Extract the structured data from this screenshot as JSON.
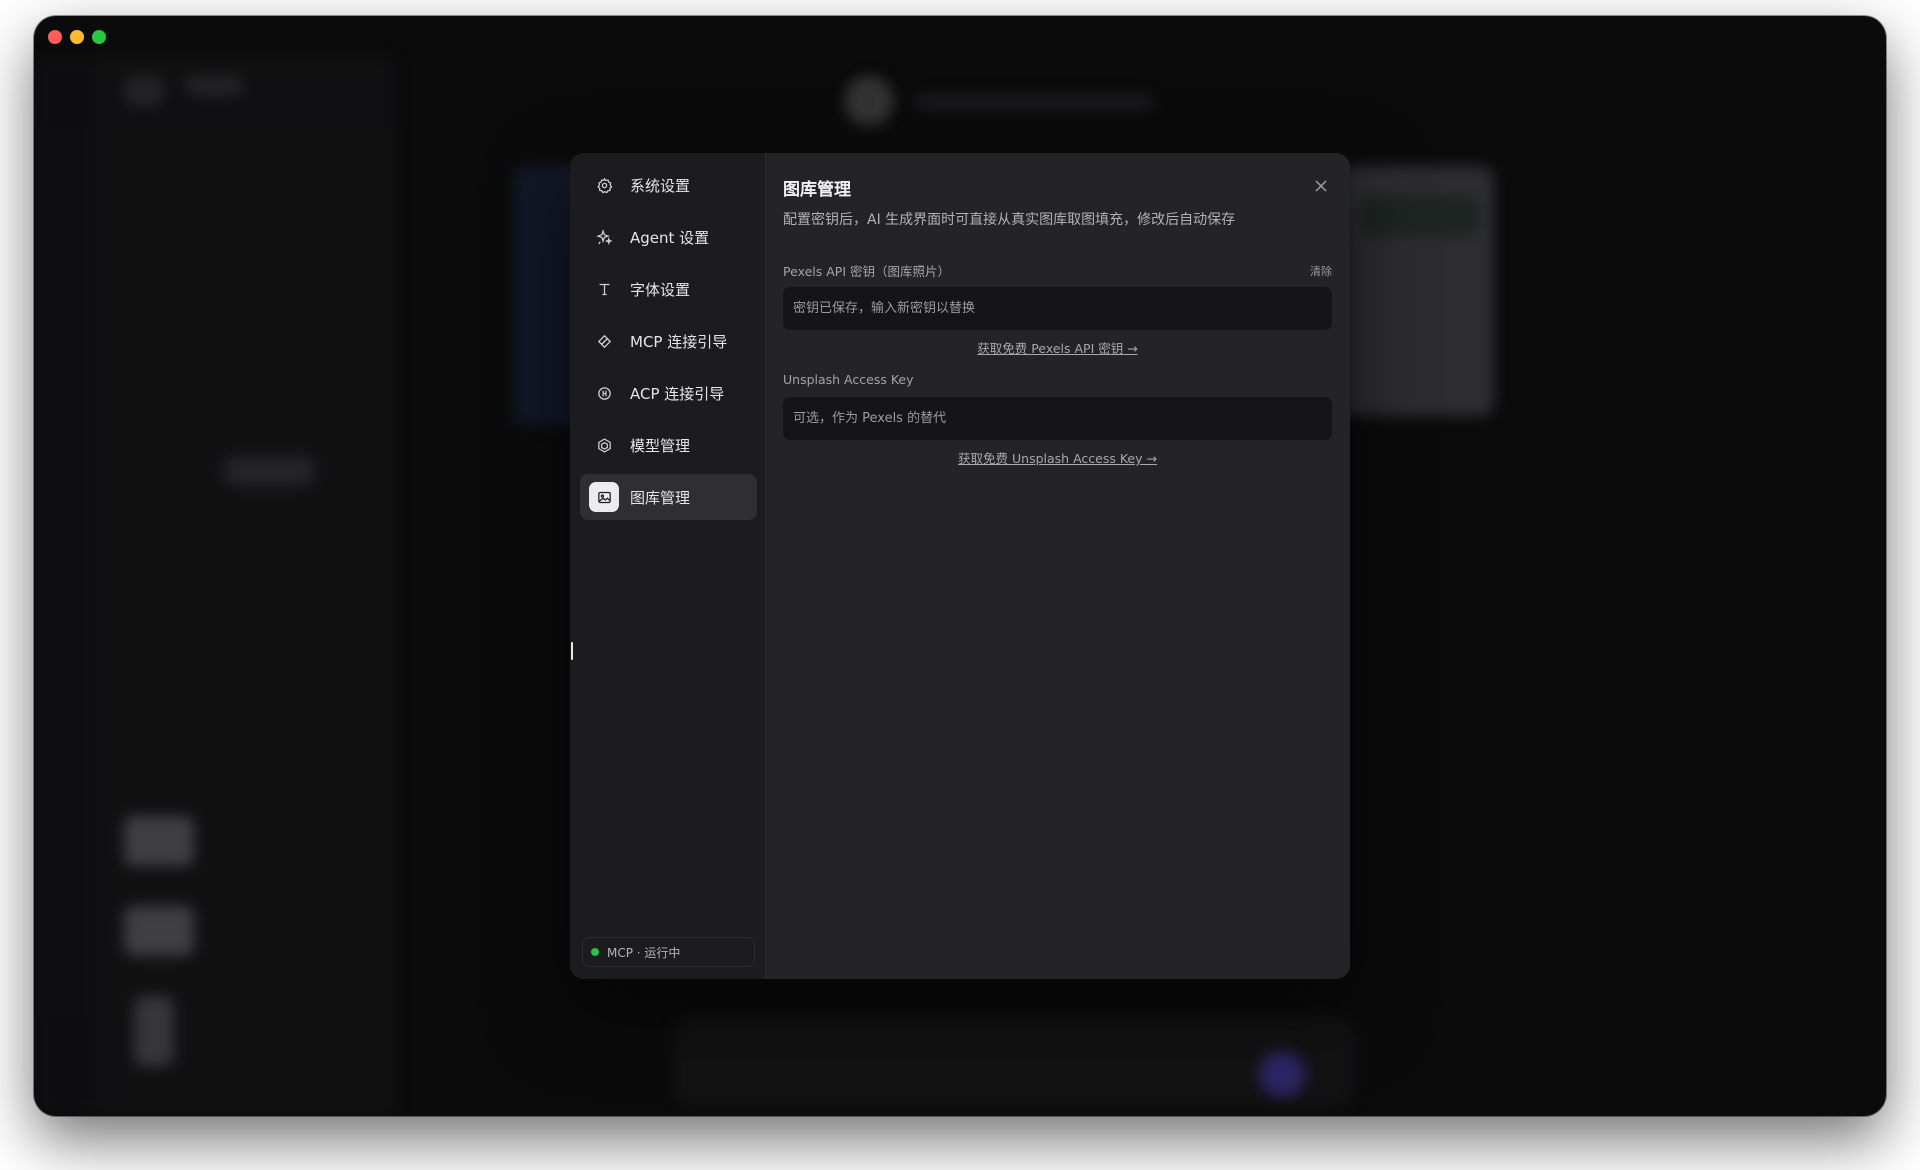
{
  "settings_nav": {
    "items": [
      {
        "label": "系统设置",
        "icon": "gear-icon"
      },
      {
        "label": "Agent 设置",
        "icon": "sparkle-icon"
      },
      {
        "label": "字体设置",
        "icon": "text-icon"
      },
      {
        "label": "MCP 连接引导",
        "icon": "mcp-icon"
      },
      {
        "label": "ACP 连接引导",
        "icon": "acp-icon"
      },
      {
        "label": "模型管理",
        "icon": "model-icon"
      },
      {
        "label": "图库管理",
        "icon": "image-icon",
        "active": true
      }
    ],
    "status": {
      "text": "MCP · 运行中",
      "color": "#26c24b"
    }
  },
  "panel": {
    "title": "图库管理",
    "description": "配置密钥后，AI 生成界面时可直接从真实图库取图填充，修改后自动保存",
    "pexels": {
      "label": "Pexels API 密钥（图库照片）",
      "clear_label": "清除",
      "placeholder": "密钥已保存，输入新密钥以替换",
      "link": "获取免费 Pexels API 密钥 →"
    },
    "unsplash": {
      "label": "Unsplash Access Key",
      "placeholder": "可选，作为 Pexels 的替代",
      "link": "获取免费 Unsplash Access Key →"
    }
  },
  "colors": {
    "accent": "#ececee",
    "status_green": "#26c24b",
    "window_bg": "#0b0b0c"
  }
}
